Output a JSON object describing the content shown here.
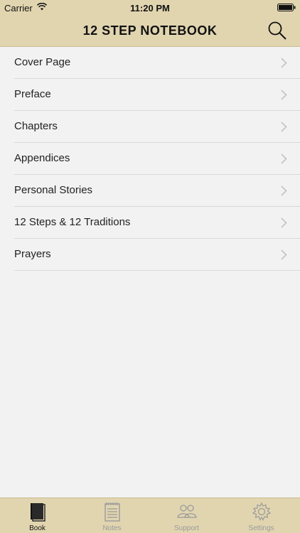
{
  "status_bar": {
    "carrier": "Carrier",
    "time": "11:20 PM"
  },
  "nav": {
    "title": "12 STEP NOTEBOOK",
    "search_icon": "search-icon"
  },
  "list": {
    "items": [
      {
        "label": "Cover Page"
      },
      {
        "label": "Preface"
      },
      {
        "label": "Chapters"
      },
      {
        "label": "Appendices"
      },
      {
        "label": "Personal Stories"
      },
      {
        "label": "12 Steps & 12 Traditions"
      },
      {
        "label": "Prayers"
      }
    ]
  },
  "tabbar": {
    "tabs": [
      {
        "label": "Book",
        "icon": "book-icon",
        "active": true
      },
      {
        "label": "Notes",
        "icon": "notes-icon",
        "active": false
      },
      {
        "label": "Support",
        "icon": "people-icon",
        "active": false
      },
      {
        "label": "Settings",
        "icon": "gear-icon",
        "active": false
      }
    ]
  },
  "colors": {
    "bar_background": "#e1d5b0",
    "page_background": "#f2f2f2",
    "separator": "#d9d9d9",
    "inactive_tab": "#9a9a9a"
  }
}
